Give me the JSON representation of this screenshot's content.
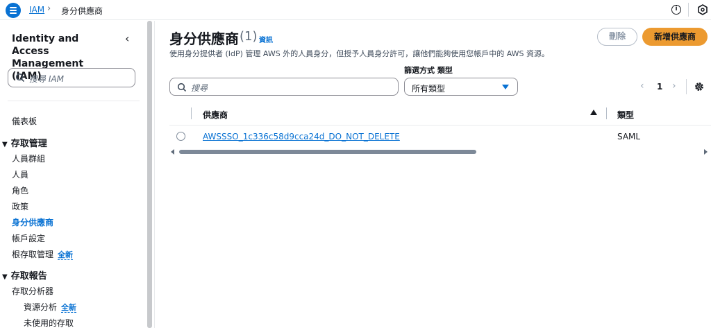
{
  "breadcrumb": {
    "root": "IAM",
    "current": "身分供應商"
  },
  "sidebar": {
    "title": "Identity and Access Management (IAM)",
    "search_placeholder": "搜尋 IAM",
    "dashboard": "儀表板",
    "access_management": {
      "heading": "存取管理",
      "items": [
        "人員群組",
        "人員",
        "角色",
        "政策",
        "身分供應商",
        "帳戶設定",
        "根存取管理"
      ],
      "active": "身分供應商",
      "new_badge": "全新"
    },
    "access_reports": {
      "heading": "存取報告",
      "items": [
        "存取分析器"
      ],
      "sub_items": [
        "資源分析",
        "未使用的存取"
      ],
      "new_badge": "全新"
    }
  },
  "page": {
    "title": "身分供應商",
    "count": "(1)",
    "info": "資訊",
    "description": "使用身分提供者 (IdP) 管理 AWS 外的人員身分，但授予人員身分許可，讓他們能夠使用您帳戶中的 AWS 資源。",
    "delete_label": "刪除",
    "add_label": "新增供應商"
  },
  "filter": {
    "search_placeholder": "搜尋",
    "label": "篩選方式 類型",
    "type_value": "所有類型"
  },
  "pagination": {
    "current_page": "1"
  },
  "table": {
    "columns": [
      "供應商",
      "類型"
    ],
    "rows": [
      {
        "provider": "AWSSSO_1c336c58d9cca24d_DO_NOT_DELETE",
        "type": "SAML"
      }
    ]
  },
  "colors": {
    "accent": "#0972d3",
    "primary_button": "#ec9a30"
  }
}
